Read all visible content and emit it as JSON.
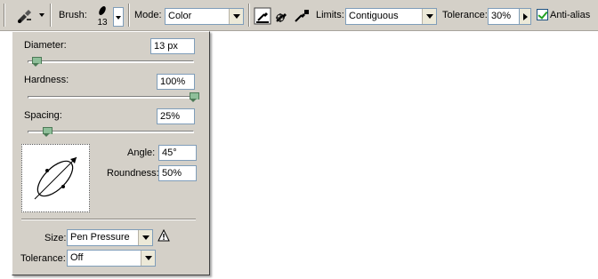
{
  "toolbar": {
    "tool_icon": "brush-eyedropper-tool-icon",
    "brush_label": "Brush:",
    "brush_size": "13",
    "mode_label": "Mode:",
    "mode_value": "Color",
    "limits_label": "Limits:",
    "limits_value": "Contiguous",
    "tolerance_label": "Tolerance:",
    "tolerance_value": "30%",
    "antialias_label": "Anti-alias",
    "antialias_checked": true,
    "sample_icons": [
      "color-sampling-continuous-icon",
      "color-sampling-once-icon",
      "color-sampling-swatch-icon"
    ]
  },
  "panel": {
    "diameter_label": "Diameter:",
    "diameter_value": "13 px",
    "diameter_slider": 0.05,
    "hardness_label": "Hardness:",
    "hardness_value": "100%",
    "hardness_slider": 1.0,
    "spacing_label": "Spacing:",
    "spacing_value": "25%",
    "spacing_slider": 0.1,
    "angle_label": "Angle:",
    "angle_value": "45°",
    "roundness_label": "Roundness:",
    "roundness_value": "50%",
    "size_label": "Size:",
    "size_value": "Pen Pressure",
    "tolerance_label": "Tolerance:",
    "tolerance_value": "Off"
  },
  "colors": {
    "chrome": "#d4d0c8",
    "field_border": "#7f9db9",
    "slider_thumb": "#8fbf9a",
    "checkmark": "#21a121"
  }
}
